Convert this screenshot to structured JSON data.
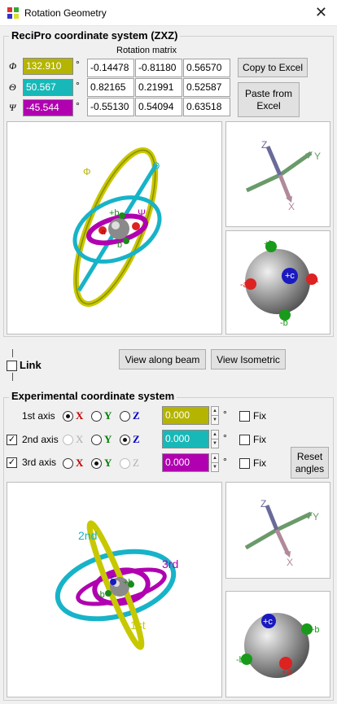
{
  "window": {
    "title": "Rotation Geometry",
    "close_glyph": "✕"
  },
  "recipro": {
    "title": "ReciPro coordinate system (ZXZ)",
    "matrix_label": "Rotation matrix",
    "angles": [
      {
        "symbol": "Φ",
        "value": "132.910",
        "unit": "°",
        "color": "#b5b400"
      },
      {
        "symbol": "Θ",
        "value": "50.567",
        "unit": "°",
        "color": "#18b8b8"
      },
      {
        "symbol": "Ψ",
        "value": "-45.544",
        "unit": "°",
        "color": "#b000b0"
      }
    ],
    "matrix": [
      [
        "-0.14478",
        "-0.81180",
        "0.56570"
      ],
      [
        "0.82165",
        "0.21991",
        "0.52587"
      ],
      [
        "-0.55130",
        "0.54094",
        "0.63518"
      ]
    ],
    "copy_button": "Copy to Excel",
    "paste_button_line1": "Paste from",
    "paste_button_line2": "Excel",
    "scene_labels": {
      "phi": "Φ",
      "theta": "Θ",
      "psi": "Ψ",
      "b": "+b",
      "a": "a",
      "b2": "b"
    },
    "axes_labels": {
      "x": "X",
      "y": "Y",
      "z": "Z"
    },
    "sphere_labels": {
      "pb": "+b",
      "pc": "+c",
      "a": "a",
      "ma": "-a",
      "mb": "-b"
    }
  },
  "link": {
    "label": "Link",
    "checked": false
  },
  "view_buttons": {
    "beam": "View along beam",
    "iso": "View Isometric"
  },
  "experimental": {
    "title": "Experimental coordinate system",
    "rows": [
      {
        "label": "1st axis",
        "checked": null,
        "selected": "X",
        "value": "0.000",
        "color": "#b5b400",
        "fix": "Fix"
      },
      {
        "label": "2nd axis",
        "checked": true,
        "selected": "Z",
        "value": "0.000",
        "color": "#18b8b8",
        "fix": "Fix"
      },
      {
        "label": "3rd axis",
        "checked": true,
        "selected": "Y",
        "value": "0.000",
        "color": "#b000b0",
        "fix": "Fix"
      }
    ],
    "axis_letters": {
      "x": "X",
      "y": "Y",
      "z": "Z"
    },
    "degree": "°",
    "reset_line1": "Reset",
    "reset_line2": "angles",
    "scene_labels": {
      "second": "2nd",
      "third": "3rd",
      "first": "1st",
      "b": "+b",
      "mb": "-b",
      "c": "c"
    },
    "axes_labels": {
      "x": "X",
      "y": "Y",
      "z": "Z"
    },
    "sphere_labels": {
      "pc": "+c",
      "pb": "+b",
      "mb": "-b",
      "pa": "+a"
    }
  }
}
